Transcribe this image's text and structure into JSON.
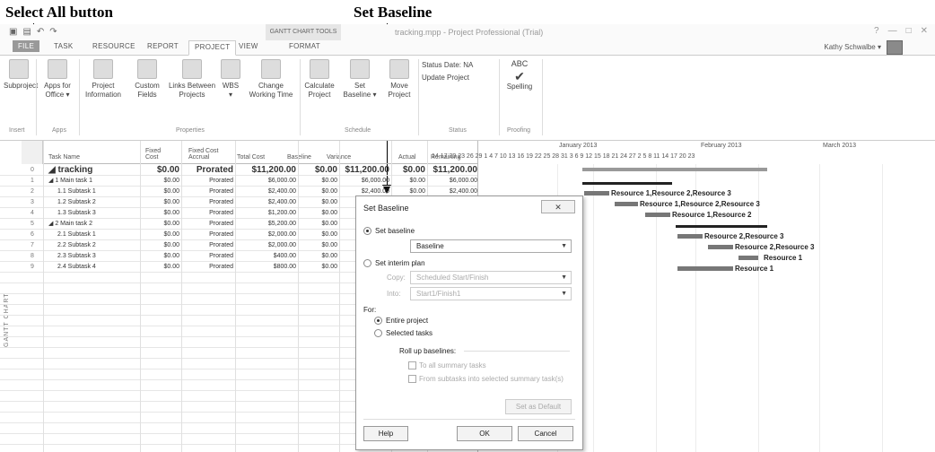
{
  "callouts": {
    "select_all": "Select All button",
    "set_baseline": "Set Baseline"
  },
  "titlebar": {
    "gantt_tools": "GANTT CHART TOOLS",
    "app_title": "tracking.mpp - Project Professional (Trial)",
    "window_controls": [
      "?",
      "—",
      "□",
      "✕"
    ]
  },
  "tabs": [
    "FILE",
    "TASK",
    "RESOURCE",
    "REPORT",
    "PROJECT",
    "VIEW",
    "FORMAT"
  ],
  "active_tab": "PROJECT",
  "user_name": "Kathy Schwalbe ▾",
  "ribbon": {
    "buttons": [
      {
        "label": "Subproject",
        "sub": ""
      },
      {
        "label": "Apps for",
        "sub": "Office ▾"
      },
      {
        "label": "Project",
        "sub": "Information"
      },
      {
        "label": "Custom",
        "sub": "Fields"
      },
      {
        "label": "Links Between",
        "sub": "Projects"
      },
      {
        "label": "WBS",
        "sub": "▾"
      },
      {
        "label": "Change",
        "sub": "Working Time"
      },
      {
        "label": "Calculate",
        "sub": "Project"
      },
      {
        "label": "Set",
        "sub": "Baseline ▾"
      },
      {
        "label": "Move",
        "sub": "Project"
      },
      {
        "label": "Spelling",
        "sub": ""
      }
    ],
    "status_date": "Status Date: NA",
    "update_project": "Update Project",
    "abc": "ABC",
    "groups": [
      "Insert",
      "Apps",
      "Properties",
      "Schedule",
      "Status",
      "Proofing"
    ]
  },
  "table": {
    "headers": [
      "Task Name",
      "Fixed Cost",
      "Fixed Cost Accrual",
      "Total Cost",
      "Baseline",
      "Variance",
      "Actual",
      "Remaining"
    ],
    "side_label": "GANTT CHART",
    "rows": [
      {
        "id": "0",
        "name": "◢ tracking",
        "fixed": "$0.00",
        "accrual": "Prorated",
        "total": "$11,200.00",
        "baseline": "$0.00",
        "variance": "$11,200.00",
        "actual": "$0.00",
        "remaining": "$11,200.00"
      },
      {
        "id": "1",
        "name": "◢ 1 Main task 1",
        "fixed": "$0.00",
        "accrual": "Prorated",
        "total": "$6,000.00",
        "baseline": "$0.00",
        "variance": "$6,000.00",
        "actual": "$0.00",
        "remaining": "$6,000.00"
      },
      {
        "id": "2",
        "name": "1.1 Subtask 1",
        "fixed": "$0.00",
        "accrual": "Prorated",
        "total": "$2,400.00",
        "baseline": "$0.00",
        "variance": "$2,400.00",
        "actual": "$0.00",
        "remaining": "$2,400.00"
      },
      {
        "id": "3",
        "name": "1.2 Subtask 2",
        "fixed": "$0.00",
        "accrual": "Prorated",
        "total": "$2,400.00",
        "baseline": "$0.00",
        "variance": "$2,4",
        "actual": "",
        "remaining": ""
      },
      {
        "id": "4",
        "name": "1.3 Subtask 3",
        "fixed": "$0.00",
        "accrual": "Prorated",
        "total": "$1,200.00",
        "baseline": "$0.00",
        "variance": "$1,2",
        "actual": "",
        "remaining": ""
      },
      {
        "id": "5",
        "name": "◢ 2 Main task 2",
        "fixed": "$0.00",
        "accrual": "Prorated",
        "total": "$5,200.00",
        "baseline": "$0.00",
        "variance": "$5,2",
        "actual": "",
        "remaining": ""
      },
      {
        "id": "6",
        "name": "2.1 Subtask 1",
        "fixed": "$0.00",
        "accrual": "Prorated",
        "total": "$2,000.00",
        "baseline": "$0.00",
        "variance": "$2,0",
        "actual": "",
        "remaining": ""
      },
      {
        "id": "7",
        "name": "2.2 Subtask 2",
        "fixed": "$0.00",
        "accrual": "Prorated",
        "total": "$2,000.00",
        "baseline": "$0.00",
        "variance": "$2,0",
        "actual": "",
        "remaining": ""
      },
      {
        "id": "8",
        "name": "2.3 Subtask 3",
        "fixed": "$0.00",
        "accrual": "Prorated",
        "total": "$400.00",
        "baseline": "$0.00",
        "variance": "$4",
        "actual": "",
        "remaining": ""
      },
      {
        "id": "9",
        "name": "2.4 Subtask 4",
        "fixed": "$0.00",
        "accrual": "Prorated",
        "total": "$800.00",
        "baseline": "$0.00",
        "variance": "$8",
        "actual": "",
        "remaining": ""
      }
    ]
  },
  "chart": {
    "months": [
      "January 2013",
      "February 2013",
      "March 2013"
    ],
    "days": "14  17  20  23  26  29   1   4   7  10  13  16  19  22  25  28  31   3   6   9  12  15  18  21  24  27   2   5   8  11  14  17  20  23",
    "resources": [
      "Resource 1,Resource 2,Resource 3",
      "Resource 1,Resource 2,Resource 3",
      "Resource 1,Resource 2",
      "Resource 2,Resource 3",
      "Resource 2,Resource 3",
      "Resource 1",
      "Resource 1"
    ]
  },
  "dialog": {
    "title": "Set Baseline",
    "set_baseline": "Set baseline",
    "baseline_value": "Baseline",
    "set_interim": "Set interim plan",
    "copy_label": "Copy:",
    "copy_value": "Scheduled Start/Finish",
    "into_label": "Into:",
    "into_value": "Start1/Finish1",
    "for_label": "For:",
    "entire_project": "Entire project",
    "selected_tasks": "Selected tasks",
    "rollup": "Roll up baselines:",
    "to_all": "To all summary tasks",
    "from_sub": "From subtasks into selected summary task(s)",
    "set_default": "Set as Default",
    "help": "Help",
    "ok": "OK",
    "cancel": "Cancel"
  }
}
